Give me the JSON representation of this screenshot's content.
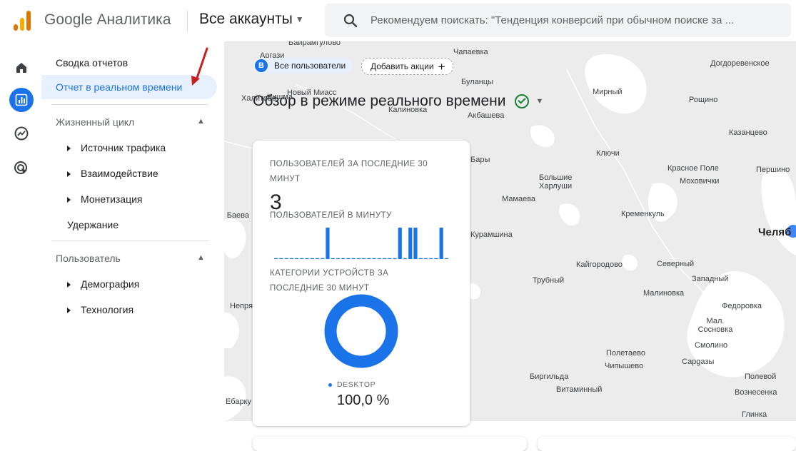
{
  "header": {
    "brand": "Google Аналитика",
    "account": "Все аккаунты",
    "search_placeholder": "Рекомендуем поискать: \"Тенденция конверсий при обычном поиске за ..."
  },
  "rail": [
    "home-icon",
    "reports-icon",
    "explore-icon",
    "advertising-icon"
  ],
  "nav": {
    "summary": "Сводка отчетов",
    "realtime": "Отчет в реальном времени",
    "lifecycle": {
      "title": "Жизненный цикл",
      "items": [
        "Источник трафика",
        "Взаимодействие",
        "Монетизация",
        "Удержание"
      ]
    },
    "user": {
      "title": "Пользователь",
      "items": [
        "Демография",
        "Технология"
      ]
    }
  },
  "filters": {
    "badge": "B",
    "segment": "Все пользователи",
    "add": "Добавить акции"
  },
  "page_title": "Обзор в режиме реального времени",
  "card": {
    "users_30_label": "ПОЛЬЗОВАТЕЛЕЙ ЗА ПОСЛЕДНИЕ 30 МИНУТ",
    "users_30_value": "3",
    "per_minute_label": "ПОЛЬЗОВАТЕЛЕЙ В МИНУТУ",
    "per_minute": [
      0,
      0,
      0,
      0,
      0,
      0,
      0,
      0,
      0,
      0,
      1,
      0,
      0,
      0,
      0,
      0,
      0,
      0,
      0,
      0,
      0,
      0,
      0,
      0,
      1,
      0,
      1,
      1,
      0,
      0,
      0,
      0,
      1,
      0
    ],
    "devices_label": "КАТЕГОРИИ УСТРОЙСТВ ЗА ПОСЛЕДНИЕ 30 МИНУТ",
    "device_name": "DESKTOP",
    "device_pct": "100,0 %",
    "device_share": 1.0
  },
  "map_towns": [
    "Аргази",
    "Байрамгулово",
    "Чапаевка",
    "Чишма",
    "Новый Миасс",
    "Халитово",
    "Буланцы",
    "Калиновка",
    "Акбашева",
    "Мирный",
    "Рощино",
    "Догдоревенское",
    "Казанцево",
    "Ключи",
    "Красное Поле",
    "Першино",
    "Моховички",
    "Большие Харлуши",
    "Мамаева",
    "Кременкуль",
    "Челяб",
    "Баева",
    "Бары",
    "Курамшина",
    "Кайгородово",
    "Северный",
    "Западный",
    "Трубный",
    "Малиновка",
    "Федоровка",
    "Непря",
    "Мал. Сосновка",
    "Смолино",
    "Полетаево",
    "Чипышево",
    "Сарgазы",
    "Биргильда",
    "Витаминный",
    "Полевой",
    "Вознесенка",
    "Ебарку",
    "Глинка"
  ],
  "colors": {
    "accent": "#1a73e8",
    "ok": "#188038"
  }
}
